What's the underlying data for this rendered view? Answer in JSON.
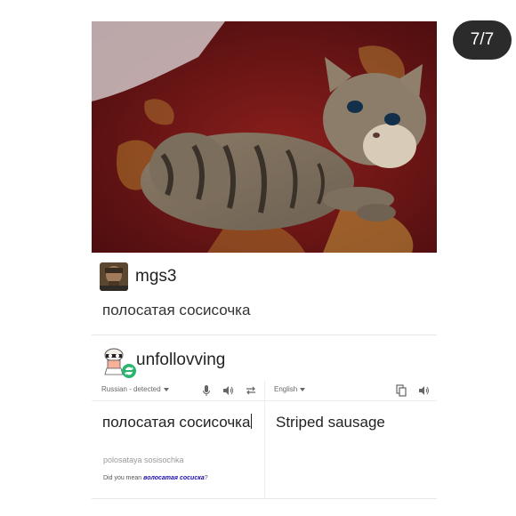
{
  "counter": "7/7",
  "post": {
    "username": "mgs3",
    "text": "полосатая сосисочка"
  },
  "reblog": {
    "username": "unfollovving"
  },
  "translator": {
    "source_lang": "Russian - detected",
    "target_lang": "English",
    "source_text": "полосатая сосисочка",
    "transliteration": "polosataya sosisochka",
    "did_you_mean_label": "Did you mean",
    "did_you_mean_value": "волосатая сосиска",
    "did_you_mean_suffix": "?",
    "translation": "Striped sausage"
  },
  "colors": {
    "badge_bg": "#2b2b2b",
    "link": "#1a0dab",
    "reblog_badge": "#2ab56e"
  },
  "icons": [
    "mic-icon",
    "speaker-icon",
    "swap-icon",
    "copy-icon",
    "reblog-icon"
  ]
}
